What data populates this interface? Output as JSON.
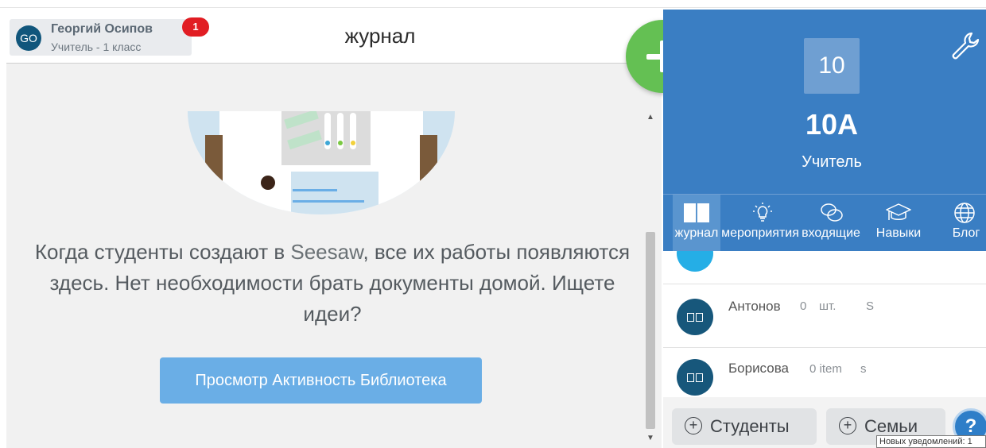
{
  "header": {
    "user_initials": "GO",
    "user_name": "Георгий Осипов",
    "user_role": "Учитель - 1 класс",
    "notification_count": "1",
    "page_title": "журнал"
  },
  "empty_state": {
    "line_part1": "Когда студенты создают в ",
    "brand": "Seesaw",
    "line_part2": ", все их работы появляются здесь. Нет необходимости брать документы домой. Ищете идеи?",
    "button_label": "Просмотр Активность Библиотека"
  },
  "class_panel": {
    "tile_label": "10",
    "class_name": "10A",
    "role": "Учитель"
  },
  "nav": {
    "items": [
      {
        "label": "журнал",
        "icon": "book-icon"
      },
      {
        "label": "мероприятия",
        "icon": "lightbulb-icon"
      },
      {
        "label": "входящие",
        "icon": "chat-bubbles-icon"
      },
      {
        "label": "Навыки",
        "icon": "graduation-cap-icon"
      },
      {
        "label": "Блог",
        "icon": "globe-icon"
      }
    ]
  },
  "students": {
    "items": [
      {
        "name": "Антонов",
        "count": "0",
        "unit": "шт.",
        "suffix": "S"
      },
      {
        "name": "Борисова",
        "count": "0 item",
        "unit": "",
        "suffix": "s"
      }
    ]
  },
  "footer": {
    "students_label": "Студенты",
    "families_label": "Семьи",
    "help_label": "?",
    "tooltip": "Новых уведомлений: 1"
  },
  "colors": {
    "brand_blue": "#3a7ec3",
    "fab_green": "#64c053",
    "library_button": "#6aaee6",
    "badge_red": "#e11d23"
  }
}
